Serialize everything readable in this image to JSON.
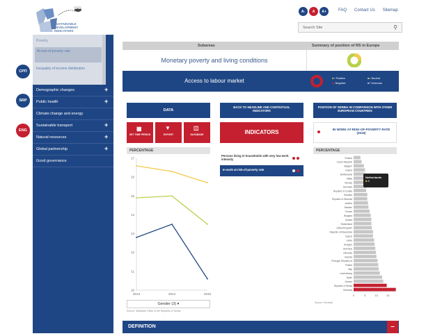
{
  "header": {
    "logo_lines": [
      "SUSTAINABLE",
      "DEVELOPMENT",
      "INDICATORS"
    ],
    "font_buttons": [
      "A-",
      "A",
      "A+"
    ],
    "links": [
      "FAQ",
      "Contact Us",
      "Sitemap"
    ],
    "search_placeholder": "Search Site"
  },
  "languages": [
    "СРП",
    "SRP",
    "ENG"
  ],
  "sidebar": {
    "sub_items": [
      "Poverty",
      "At-risk-of-poverty rate",
      "Inequality of income distribution"
    ],
    "items": [
      {
        "label": "Demographic changes",
        "plus": true
      },
      {
        "label": "Public health",
        "plus": true
      },
      {
        "label": "Climate change and energy",
        "plus": false
      },
      {
        "label": "Sustainable transport",
        "plus": true
      },
      {
        "label": "Natural resources",
        "plus": true
      },
      {
        "label": "Global partnership",
        "plus": true
      },
      {
        "label": "Good governance",
        "plus": false
      }
    ]
  },
  "main": {
    "subareas_header": "Subareas",
    "summary_header": "Summary of position of RS in Europe",
    "subarea_current": "Monetary poverty and living conditions",
    "subarea_active": "Access to labour market",
    "legend": [
      "+ Positive",
      "= Neutral",
      "- Negative",
      "? Unknown"
    ],
    "data_btn": "DATA",
    "data_actions": [
      "SET TIME PERIOD",
      "EXPORT",
      "DATABASE"
    ],
    "back_btn": "BACK TO HEADLINE AND CONTEXTUAL INDICATORS",
    "indicators_btn": "INDICATORS",
    "indicator_items": [
      "Persons living in households with very low work intensity",
      "In-work at-risk-of-poverty rate"
    ],
    "position_btn": "POSITION OF SERBIA IN COMPARISON WITH OTHER EUROPEAN COUNTRIES",
    "position_indicator": "IN WORK AT-RISK-OF-POVERTY RATE (2015)",
    "percentage_label": "PERCENTAGE",
    "gender_select": "Gender (3)",
    "source_left": "Source: Statistical Office of the Republic of Serbia",
    "source_right": "Source: Eurostat",
    "tooltip": {
      "country": "Netherlands",
      "value": "5"
    },
    "definition": "DEFINITION",
    "definition_toggle": "–"
  },
  "colors": {
    "navy": "#1f4684",
    "red": "#c4202f",
    "yellow": "#f2c94c",
    "green": "#b8d14a",
    "bar": "#c6c6c6",
    "serbia": "#c4202f"
  },
  "chart_data": [
    {
      "type": "line",
      "x": [
        2013,
        2014,
        2015
      ],
      "ylim": [
        10,
        17
      ],
      "yticks": [
        10,
        11,
        12,
        13,
        14,
        15,
        16,
        17
      ],
      "series": [
        {
          "values": [
            16.6,
            16.3,
            15.7
          ],
          "color": "#f2c94c"
        },
        {
          "values": [
            14.9,
            15.0,
            13.5
          ],
          "color": "#b8d14a"
        },
        {
          "values": [
            12.8,
            13.5,
            10.6
          ],
          "color": "#1f4684"
        }
      ]
    },
    {
      "type": "bar",
      "orientation": "horizontal",
      "xlim": [
        0,
        15
      ],
      "xticks": [
        0,
        5,
        10,
        15
      ],
      "categories": [
        "Finland",
        "Czech Republic",
        "Belgium",
        "Ireland",
        "Netherlands",
        "Malta",
        "Norway",
        "Denmark",
        "Republic of Croatia",
        "Slovakia",
        "Republic of Slovenia",
        "Iceland",
        "Sweden",
        "France",
        "Bulgaria",
        "Austria",
        "Switzerland",
        "United Kingdom",
        "Republic of Macedonia",
        "Cyprus",
        "Latvia",
        "Hungary",
        "Germany",
        "Lithuania",
        "Estonia",
        "Portugal, Republic of",
        "Poland",
        "Italy",
        "Luxembourg",
        "Spain",
        "Greece",
        "Republic of Serbia",
        "Romania"
      ],
      "values": [
        3,
        3.5,
        4.5,
        5,
        5,
        5.5,
        5.5,
        5.5,
        5.5,
        6,
        6,
        6.3,
        6.5,
        7,
        7.5,
        7.8,
        7.8,
        8,
        8.5,
        8.5,
        9,
        9.2,
        9.5,
        9.8,
        10,
        10.5,
        10.8,
        11,
        11.5,
        12.5,
        13,
        14.5,
        18.5
      ],
      "highlight": [
        "Republic of Serbia",
        "Romania"
      ]
    }
  ]
}
